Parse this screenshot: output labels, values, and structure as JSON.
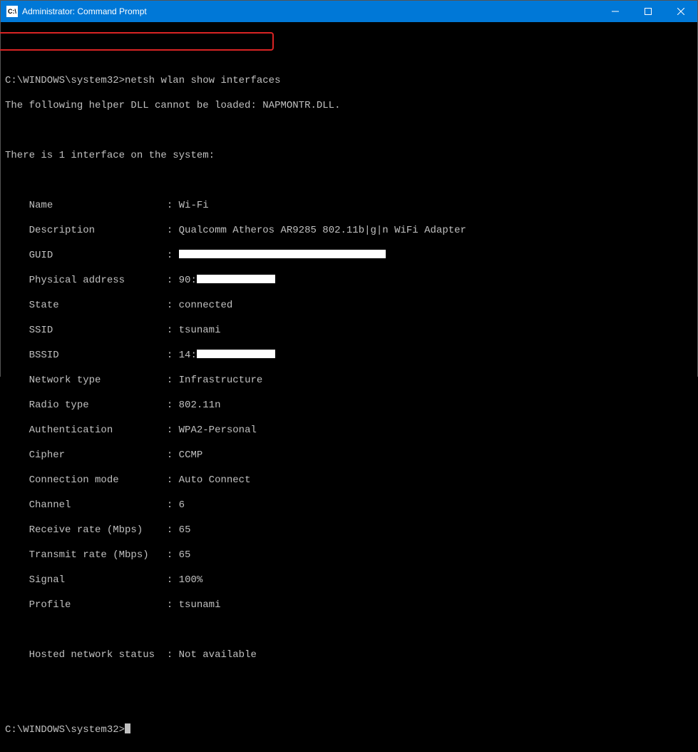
{
  "window": {
    "title": "Administrator: Command Prompt",
    "icon_label": "C:\\"
  },
  "terminal": {
    "prompt1_path": "C:\\WINDOWS\\system32>",
    "command": "netsh wlan show interfaces",
    "helper_line_prefix": "The following helper DLL cannot be loaded: ",
    "helper_line_suffix": "NAPMONTR.DLL.",
    "interface_count_line": "There is 1 interface on the system:",
    "fields": {
      "name": {
        "label": "Name",
        "value": "Wi-Fi"
      },
      "description": {
        "label": "Description",
        "value": "Qualcomm Atheros AR9285 802.11b|g|n WiFi Adapter"
      },
      "guid": {
        "label": "GUID",
        "value": ""
      },
      "physical_address": {
        "label": "Physical address",
        "value_prefix": "90:"
      },
      "state": {
        "label": "State",
        "value": "connected"
      },
      "ssid": {
        "label": "SSID",
        "value": "tsunami"
      },
      "bssid": {
        "label": "BSSID",
        "value_prefix": "14:"
      },
      "network_type": {
        "label": "Network type",
        "value": "Infrastructure"
      },
      "radio_type": {
        "label": "Radio type",
        "value": "802.11n"
      },
      "authentication": {
        "label": "Authentication",
        "value": "WPA2-Personal"
      },
      "cipher": {
        "label": "Cipher",
        "value": "CCMP"
      },
      "connection_mode": {
        "label": "Connection mode",
        "value": "Auto Connect"
      },
      "channel": {
        "label": "Channel",
        "value": "6"
      },
      "receive_rate": {
        "label": "Receive rate (Mbps)",
        "value": "65"
      },
      "transmit_rate": {
        "label": "Transmit rate (Mbps)",
        "value": "65"
      },
      "signal": {
        "label": "Signal",
        "value": "100%"
      },
      "profile": {
        "label": "Profile",
        "value": "tsunami"
      },
      "hosted_network": {
        "label": "Hosted network status",
        "value": "Not available"
      }
    },
    "prompt2_path": "C:\\WINDOWS\\system32>"
  }
}
